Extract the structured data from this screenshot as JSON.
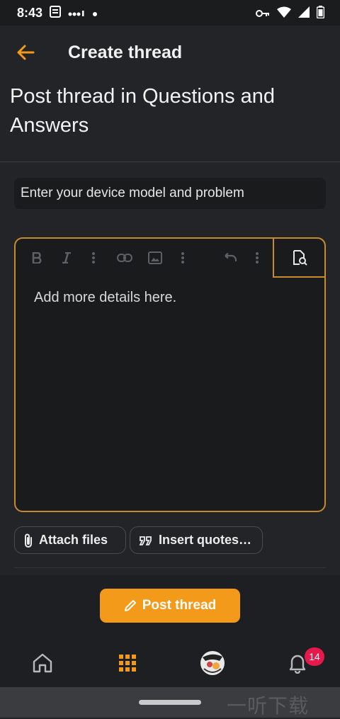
{
  "status_bar": {
    "time": "8:43",
    "icons": [
      "clipboard-icon",
      "signal-dots-icon",
      "dot-icon",
      "key-icon",
      "wifi-icon",
      "cell-signal-icon",
      "battery-icon"
    ]
  },
  "app_bar": {
    "title": "Create thread",
    "back_icon": "arrow-left-icon"
  },
  "heading": "Post thread in Questions and Answers",
  "title_field": {
    "placeholder": "Enter your device model and problem",
    "value": ""
  },
  "editor": {
    "placeholder": "Add more details here.",
    "toolbar": [
      "bold-icon",
      "italic-icon",
      "more-vert-icon",
      "link-icon",
      "image-icon",
      "more-vert-icon",
      "undo-icon",
      "more-vert-icon",
      "preview-icon"
    ]
  },
  "actions": {
    "attach_files": "Attach files",
    "insert_quotes": "Insert quotes…"
  },
  "post_button": "Post thread",
  "nav": {
    "items": [
      "home-icon",
      "apps-grid-icon",
      "avatar",
      "notifications-icon"
    ],
    "notification_count": "14"
  },
  "watermark": "一听下载",
  "colors": {
    "accent": "#f39a1b",
    "badge": "#e5194c",
    "background": "#232427"
  }
}
